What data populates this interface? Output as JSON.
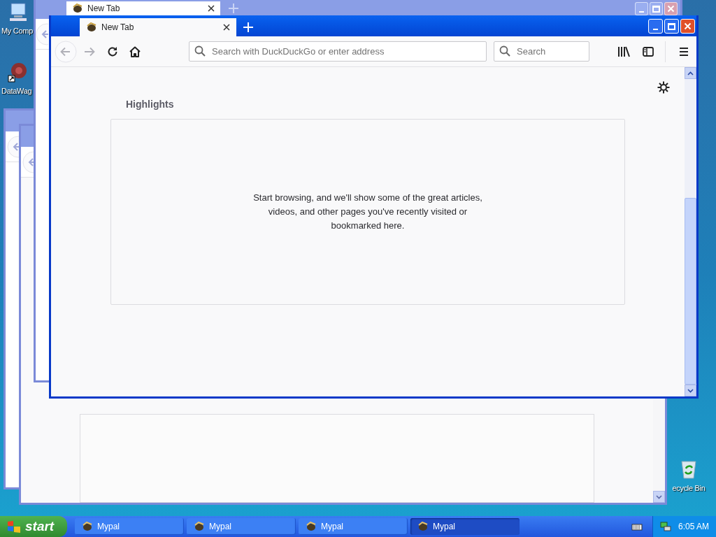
{
  "desktop_icons": [
    {
      "label": "My Comp",
      "kind": "computer"
    },
    {
      "label": "DataWag",
      "kind": "shortcut"
    },
    {
      "label": "ecycle Bin",
      "kind": "recycle"
    }
  ],
  "background_window": {
    "tab_title": "New Tab"
  },
  "window": {
    "tab_title": "New Tab",
    "address_placeholder": "Search with DuckDuckGo or enter address",
    "search_placeholder": "Search",
    "section_title": "Highlights",
    "empty_message": "Start browsing, and we'll show some of the great articles, videos, and other pages you've recently visited or bookmarked here."
  },
  "taskbar": {
    "start": "start",
    "buttons": [
      {
        "label": "Mypal",
        "selected": false
      },
      {
        "label": "Mypal",
        "selected": false
      },
      {
        "label": "Mypal",
        "selected": false
      },
      {
        "label": "Mypal",
        "selected": true
      }
    ],
    "clock": "6:05 AM"
  }
}
